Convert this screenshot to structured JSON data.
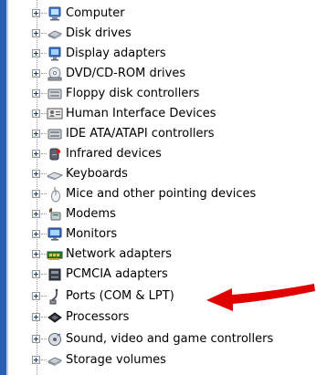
{
  "device_tree": {
    "items": [
      {
        "label": "Computer",
        "icon": "computer-icon"
      },
      {
        "label": "Disk drives",
        "icon": "disk-drive-icon"
      },
      {
        "label": "Display adapters",
        "icon": "display-adapter-icon"
      },
      {
        "label": "DVD/CD-ROM drives",
        "icon": "dvd-drive-icon"
      },
      {
        "label": "Floppy disk controllers",
        "icon": "floppy-controller-icon"
      },
      {
        "label": "Human Interface Devices",
        "icon": "hid-icon"
      },
      {
        "label": "IDE ATA/ATAPI controllers",
        "icon": "ide-controller-icon"
      },
      {
        "label": "Infrared devices",
        "icon": "infrared-icon"
      },
      {
        "label": "Keyboards",
        "icon": "keyboard-icon"
      },
      {
        "label": "Mice and other pointing devices",
        "icon": "mouse-icon"
      },
      {
        "label": "Modems",
        "icon": "modem-icon"
      },
      {
        "label": "Monitors",
        "icon": "monitor-icon"
      },
      {
        "label": "Network adapters",
        "icon": "network-adapter-icon"
      },
      {
        "label": "PCMCIA adapters",
        "icon": "pcmcia-icon"
      },
      {
        "label": "Ports (COM & LPT)",
        "icon": "port-icon"
      },
      {
        "label": "Processors",
        "icon": "processor-icon"
      },
      {
        "label": "Sound, video and game controllers",
        "icon": "sound-icon"
      },
      {
        "label": "Storage volumes",
        "icon": "storage-volume-icon"
      }
    ]
  },
  "annotation": {
    "icon": "red-arrow-icon",
    "color": "#e00000"
  },
  "colors": {
    "window_edge": "#2b5fb4",
    "tree_lines": "#9a9a9a"
  }
}
